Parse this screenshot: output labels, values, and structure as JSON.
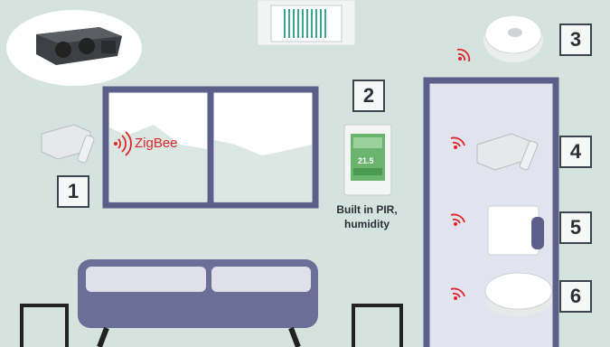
{
  "labels": {
    "zigbee": "ZigBee",
    "pir_caption_line1": "Built in PIR,",
    "pir_caption_line2": "humidity",
    "thermostat_display": "21.5"
  },
  "markers": [
    "1",
    "2",
    "3",
    "4",
    "5",
    "6"
  ],
  "icons": {
    "signal": "wireless-signal-icon",
    "hvac": "ducted-air-unit-icon",
    "ceiling": "ceiling-cassette-icon"
  },
  "colors": {
    "background": "#d4e3de",
    "frame": "#5b5f8a",
    "signal": "#e2262a",
    "sofa": "#6b6e97"
  }
}
